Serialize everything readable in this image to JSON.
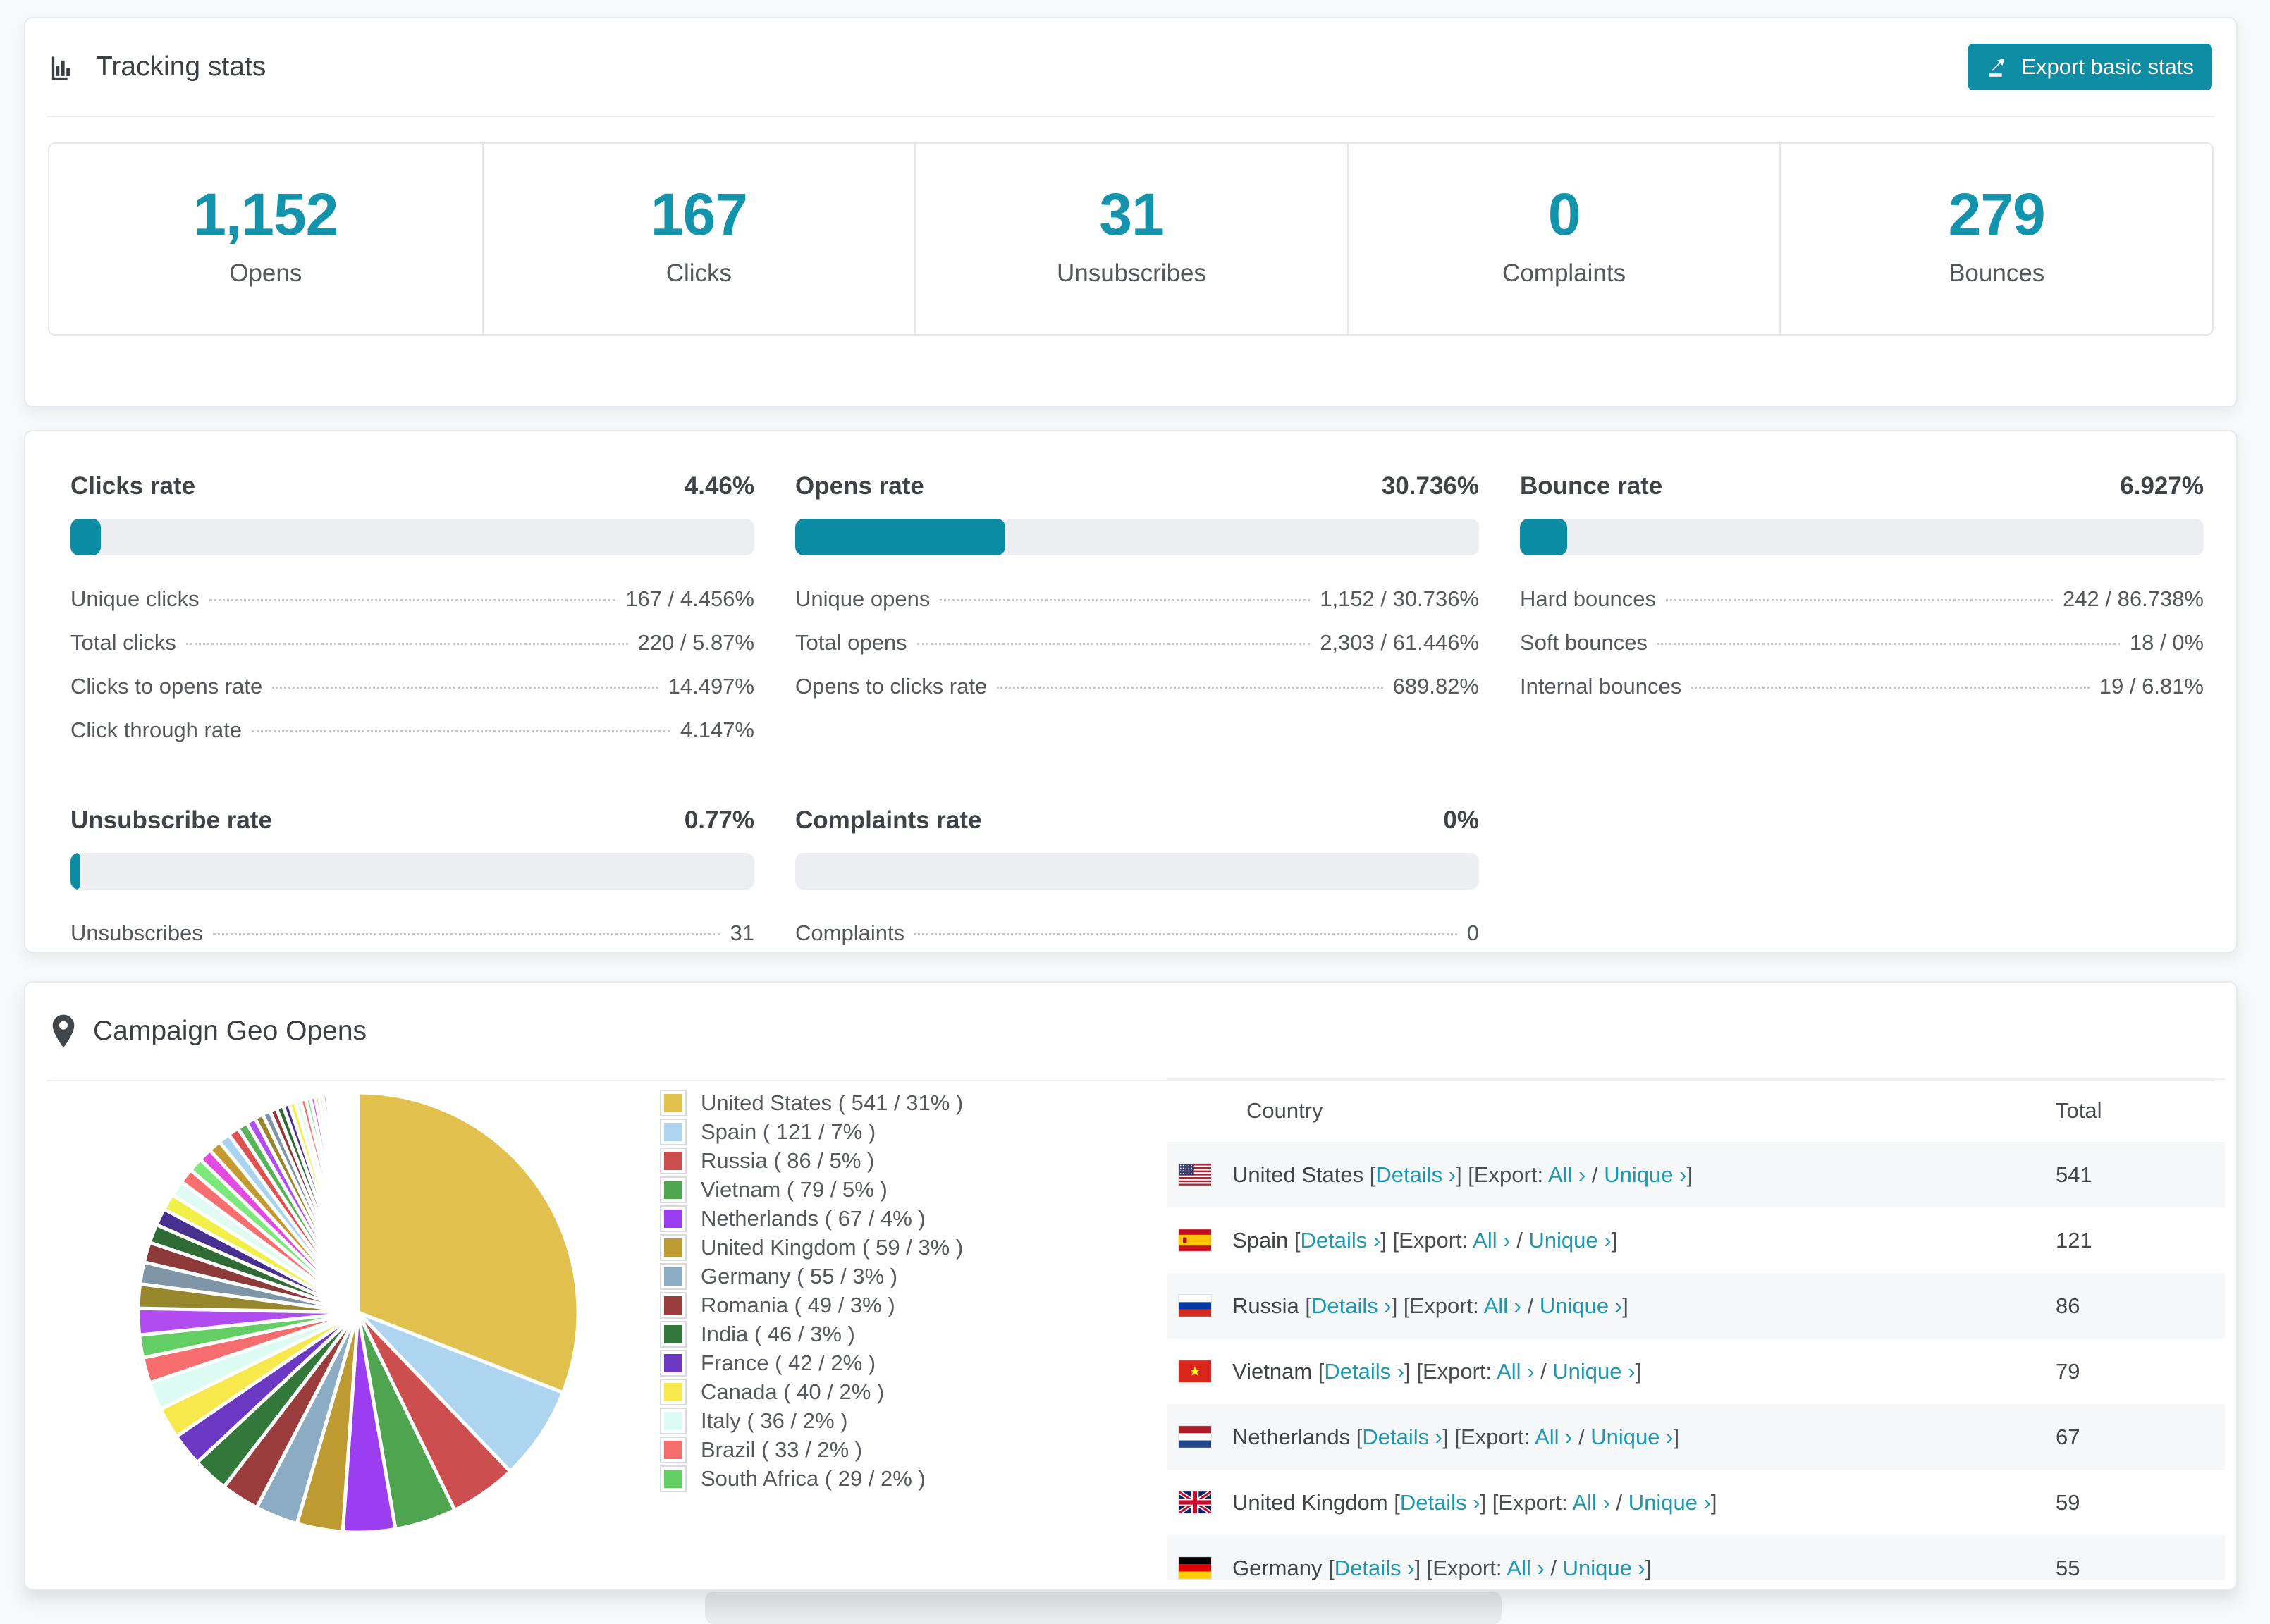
{
  "tracking": {
    "title": "Tracking stats",
    "export_button": "Export basic stats",
    "stats": [
      {
        "value": "1,152",
        "label": "Opens"
      },
      {
        "value": "167",
        "label": "Clicks"
      },
      {
        "value": "31",
        "label": "Unsubscribes"
      },
      {
        "value": "0",
        "label": "Complaints"
      },
      {
        "value": "279",
        "label": "Bounces"
      }
    ]
  },
  "rates": {
    "accent_color": "#0b8ca4",
    "cards": [
      {
        "title": "Clicks rate",
        "value": "4.46%",
        "percent": 4.46,
        "rows": [
          {
            "label": "Unique clicks",
            "value": "167 / 4.456%"
          },
          {
            "label": "Total clicks",
            "value": "220 / 5.87%"
          },
          {
            "label": "Clicks to opens rate",
            "value": "14.497%"
          },
          {
            "label": "Click through rate",
            "value": "4.147%"
          }
        ]
      },
      {
        "title": "Opens rate",
        "value": "30.736%",
        "percent": 30.736,
        "rows": [
          {
            "label": "Unique opens",
            "value": "1,152 / 30.736%"
          },
          {
            "label": "Total opens",
            "value": "2,303 / 61.446%"
          },
          {
            "label": "Opens to clicks rate",
            "value": "689.82%"
          }
        ]
      },
      {
        "title": "Bounce rate",
        "value": "6.927%",
        "percent": 6.927,
        "rows": [
          {
            "label": "Hard bounces",
            "value": "242 / 86.738%"
          },
          {
            "label": "Soft bounces",
            "value": "18 / 0%"
          },
          {
            "label": "Internal bounces",
            "value": "19 / 6.81%"
          }
        ]
      },
      {
        "title": "Unsubscribe rate",
        "value": "0.77%",
        "percent": 0.77,
        "rows": [
          {
            "label": "Unsubscribes",
            "value": "31"
          }
        ]
      },
      {
        "title": "Complaints rate",
        "value": "0%",
        "percent": 0,
        "rows": [
          {
            "label": "Complaints",
            "value": "0"
          }
        ]
      }
    ]
  },
  "geo": {
    "title": "Campaign Geo Opens",
    "table": {
      "columns": [
        "Country",
        "Total"
      ],
      "link_labels": {
        "details": "Details ›",
        "export_prefix": "Export:",
        "all": "All ›",
        "unique": "Unique ›"
      },
      "rows": [
        {
          "country": "United States",
          "flag": "us",
          "total": "541"
        },
        {
          "country": "Spain",
          "flag": "es",
          "total": "121"
        },
        {
          "country": "Russia",
          "flag": "ru",
          "total": "86"
        },
        {
          "country": "Vietnam",
          "flag": "vn",
          "total": "79"
        },
        {
          "country": "Netherlands",
          "flag": "nl",
          "total": "67"
        },
        {
          "country": "United Kingdom",
          "flag": "gb",
          "total": "59"
        },
        {
          "country": "Germany",
          "flag": "de",
          "total": "55"
        }
      ]
    }
  },
  "chart_data": {
    "type": "pie",
    "title": "Campaign Geo Opens",
    "legend_position": "right",
    "series": [
      {
        "name": "United States",
        "value": 541,
        "pct": "31%",
        "color": "#e2c04d"
      },
      {
        "name": "Spain",
        "value": 121,
        "pct": "7%",
        "color": "#aed5f0"
      },
      {
        "name": "Russia",
        "value": 86,
        "pct": "5%",
        "color": "#cc4e4e"
      },
      {
        "name": "Vietnam",
        "value": 79,
        "pct": "5%",
        "color": "#4fa44f"
      },
      {
        "name": "Netherlands",
        "value": 67,
        "pct": "4%",
        "color": "#9b3df0"
      },
      {
        "name": "United Kingdom",
        "value": 59,
        "pct": "3%",
        "color": "#bd9b31"
      },
      {
        "name": "Germany",
        "value": 55,
        "pct": "3%",
        "color": "#8cacc6"
      },
      {
        "name": "Romania",
        "value": 49,
        "pct": "3%",
        "color": "#9c3d3d"
      },
      {
        "name": "India",
        "value": 46,
        "pct": "3%",
        "color": "#31783a"
      },
      {
        "name": "France",
        "value": 42,
        "pct": "2%",
        "color": "#6a38c2"
      },
      {
        "name": "Canada",
        "value": 40,
        "pct": "2%",
        "color": "#f7e84b"
      },
      {
        "name": "Italy",
        "value": 36,
        "pct": "2%",
        "color": "#dcfbf3"
      },
      {
        "name": "Brazil",
        "value": 33,
        "pct": "2%",
        "color": "#f66d6d"
      },
      {
        "name": "South Africa",
        "value": 29,
        "pct": "2%",
        "color": "#63ce63"
      }
    ],
    "others_unlabeled": {
      "values": [
        34,
        31,
        28,
        26,
        24,
        22,
        21,
        20,
        19,
        18,
        17,
        16,
        15,
        14,
        13,
        12,
        11,
        10,
        9,
        9,
        8,
        8,
        7,
        7,
        6,
        6,
        5,
        5,
        5,
        4,
        4,
        4,
        3,
        3,
        3,
        3,
        2,
        2,
        2,
        2,
        2,
        1,
        1,
        1,
        1,
        1,
        1
      ],
      "palette": [
        "#b14cf0",
        "#97872c",
        "#7e95a8",
        "#8e3a3a",
        "#2f6b34",
        "#473090",
        "#f2ef49",
        "#e0fbf4",
        "#f96f6f",
        "#7ce87c",
        "#e24ae2",
        "#c49a30",
        "#a9d3f2",
        "#e05252",
        "#57b357"
      ]
    }
  }
}
